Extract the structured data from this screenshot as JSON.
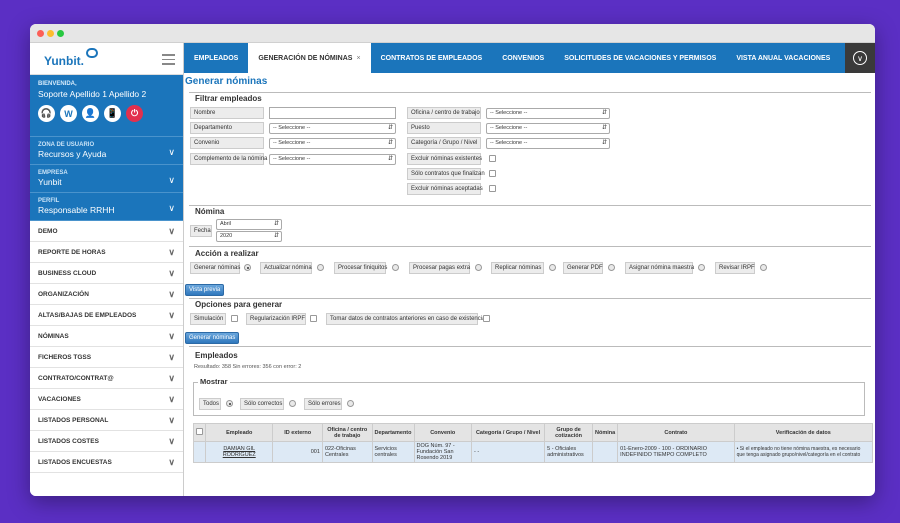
{
  "app": {
    "logo": "Yunbit.",
    "colors": {
      "brand": "#1b75bb",
      "background": "#5b2fc4",
      "logout": "#e2304e"
    }
  },
  "sidebar": {
    "welcome": "BIENVENIDA,",
    "username": "Soporte Apellido 1 Apellido 2",
    "quick_icons": [
      {
        "icon": "headset-icon",
        "glyph": "🎧"
      },
      {
        "icon": "wikipedia-icon",
        "glyph": "W"
      },
      {
        "icon": "user-icon",
        "glyph": "👤"
      },
      {
        "icon": "phone-icon",
        "glyph": "📱"
      },
      {
        "icon": "logout-icon",
        "glyph": "⏻"
      }
    ],
    "user_zone": {
      "label": "ZONA DE USUARIO",
      "value": "Recursos y Ayuda"
    },
    "company": {
      "label": "EMPRESA",
      "value": "Yunbit"
    },
    "profile": {
      "label": "PERFIL",
      "value": "Responsable RRHH"
    },
    "items": [
      "DEMO",
      "REPORTE DE HORAS",
      "BUSINESS CLOUD",
      "ORGANIZACIÓN",
      "ALTAS/BAJAS DE EMPLEADOS",
      "NÓMINAS",
      "FICHEROS TGSS",
      "CONTRATO/CONTRAT@",
      "VACACIONES",
      "LISTADOS PERSONAL",
      "LISTADOS COSTES",
      "LISTADOS ENCUESTAS"
    ]
  },
  "tabs": [
    {
      "label": "EMPLEADOS",
      "active": false
    },
    {
      "label": "GENERACIÓN DE NÓMINAS",
      "active": true,
      "close": "×"
    },
    {
      "label": "CONTRATOS DE EMPLEADOS",
      "active": false
    },
    {
      "label": "CONVENIOS",
      "active": false
    },
    {
      "label": "SOLICITUDES DE VACACIONES Y PERMISOS",
      "active": false
    },
    {
      "label": "VISTA ANUAL VACACIONES",
      "active": false
    }
  ],
  "page": {
    "title": "Generar nóminas",
    "filter": {
      "title": "Filtrar empleados",
      "nombre": "Nombre",
      "departamento": "Departamento",
      "convenio": "Convenio",
      "complemento": "Complemento de la nómina",
      "oficina": "Oficina / centro de trabajo",
      "puesto": "Puesto",
      "categoria": "Categoría / Grupo / Nivel",
      "excluir_existentes": "Excluir nóminas existentes",
      "solo_contratos": "Sólo contratos que finalizan",
      "excluir_aceptadas": "Excluir nóminas aceptadas",
      "select_placeholder": "-- Seleccione --"
    },
    "nomina": {
      "title": "Nómina",
      "fecha": "Fecha",
      "month": "Abril",
      "year": "2020"
    },
    "accion": {
      "title": "Acción a realizar",
      "options": [
        "Generar nóminas",
        "Actualizar nómina",
        "Procesar finiquitos",
        "Procesar pagas extra",
        "Replicar nóminas",
        "Generar PDF",
        "Asignar nómina maestra",
        "Revisar IRPF"
      ],
      "selected": 0,
      "preview_button": "Vista previa"
    },
    "opciones": {
      "title": "Opciones para generar",
      "simulacion": "Simulación",
      "regularizacion": "Regularización IRPF",
      "tomar_datos": "Tomar datos de contratos anteriores en caso de existencia",
      "generate_button": "Generar nóminas"
    },
    "empleados": {
      "title": "Empleados",
      "result_text": "Resultado: 358   Sin errores: 356   con error: 2",
      "mostrar": {
        "legend": "Mostrar",
        "options": [
          "Todos",
          "Sólo correctos",
          "Sólo errores"
        ],
        "selected": 0
      },
      "columns": [
        "Empleado",
        "ID externo",
        "Oficina / centro de trabajo",
        "Departamento",
        "Convenio",
        "Categoría / Grupo / Nivel",
        "Grupo de cotización",
        "Nómina",
        "Contrato",
        "Verificación de datos"
      ],
      "rows": [
        {
          "empleado": "DAMIAN GIL RODRIGUEZ",
          "id": "001",
          "oficina": "022-Oficinas Centrales",
          "departamento": "Servicios centrales",
          "convenio": "DOG Núm. 97 - Fundación San Rosendo 2019",
          "categoria": "- -",
          "grupo": "5 - Oficiales administrativos",
          "nomina": "",
          "contrato": "01-Enero-2009 - 100 - ORDINARIO INDEFINIDO TIEMPO COMPLETO",
          "verificacion": "• Si el empleado no tiene nómina maestra, es necesario que tenga asignado grupo/nivel/categoría en el contrato"
        }
      ]
    }
  }
}
